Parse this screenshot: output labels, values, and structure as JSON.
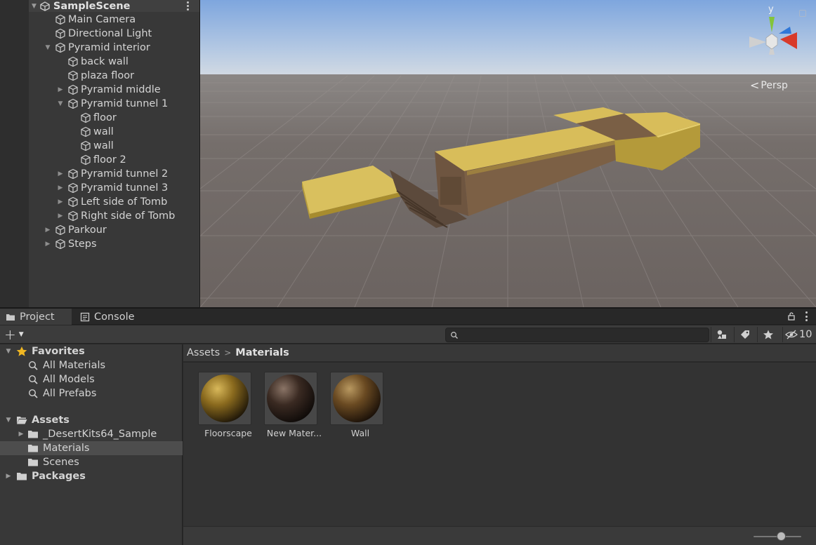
{
  "hierarchy": {
    "scene_name": "SampleScene",
    "items": [
      {
        "label": "Main Camera"
      },
      {
        "label": "Directional Light"
      },
      {
        "label": "Pyramid interior"
      },
      {
        "label": "back wall"
      },
      {
        "label": "plaza floor"
      },
      {
        "label": "Pyramid middle"
      },
      {
        "label": "Pyramid tunnel 1"
      },
      {
        "label": "floor"
      },
      {
        "label": "wall"
      },
      {
        "label": "wall"
      },
      {
        "label": "floor 2"
      },
      {
        "label": "Pyramid tunnel 2"
      },
      {
        "label": "Pyramid tunnel 3"
      },
      {
        "label": "Left side of Tomb"
      },
      {
        "label": "Right side of Tomb"
      },
      {
        "label": "Parkour"
      },
      {
        "label": "Steps"
      }
    ]
  },
  "scene_view": {
    "gizmo_axis_label": "y",
    "projection_label": "Persp",
    "colors": {
      "sky": "#a7c2e6",
      "ground": "#6f6866",
      "sand": "#d8bf5a",
      "stone": "#7a5f45"
    }
  },
  "project_panel": {
    "tabs": [
      {
        "label": "Project",
        "icon": "folder-icon"
      },
      {
        "label": "Console",
        "icon": "console-icon"
      }
    ],
    "search": {
      "placeholder": "",
      "value": ""
    },
    "hidden_packages_count": "10",
    "favorites": {
      "label": "Favorites",
      "items": [
        "All Materials",
        "All Models",
        "All Prefabs"
      ]
    },
    "assets": {
      "label": "Assets",
      "children": [
        "_DesertKits64_Sample",
        "Materials",
        "Scenes"
      ]
    },
    "packages": {
      "label": "Packages"
    },
    "breadcrumb": {
      "root": "Assets",
      "current": "Materials"
    },
    "materials": [
      {
        "name": "Floorscape",
        "color": "#8a6a1e"
      },
      {
        "name": "New Mater...",
        "color": "#3a2a22"
      },
      {
        "name": "Wall",
        "color": "#6a4a22"
      }
    ]
  }
}
